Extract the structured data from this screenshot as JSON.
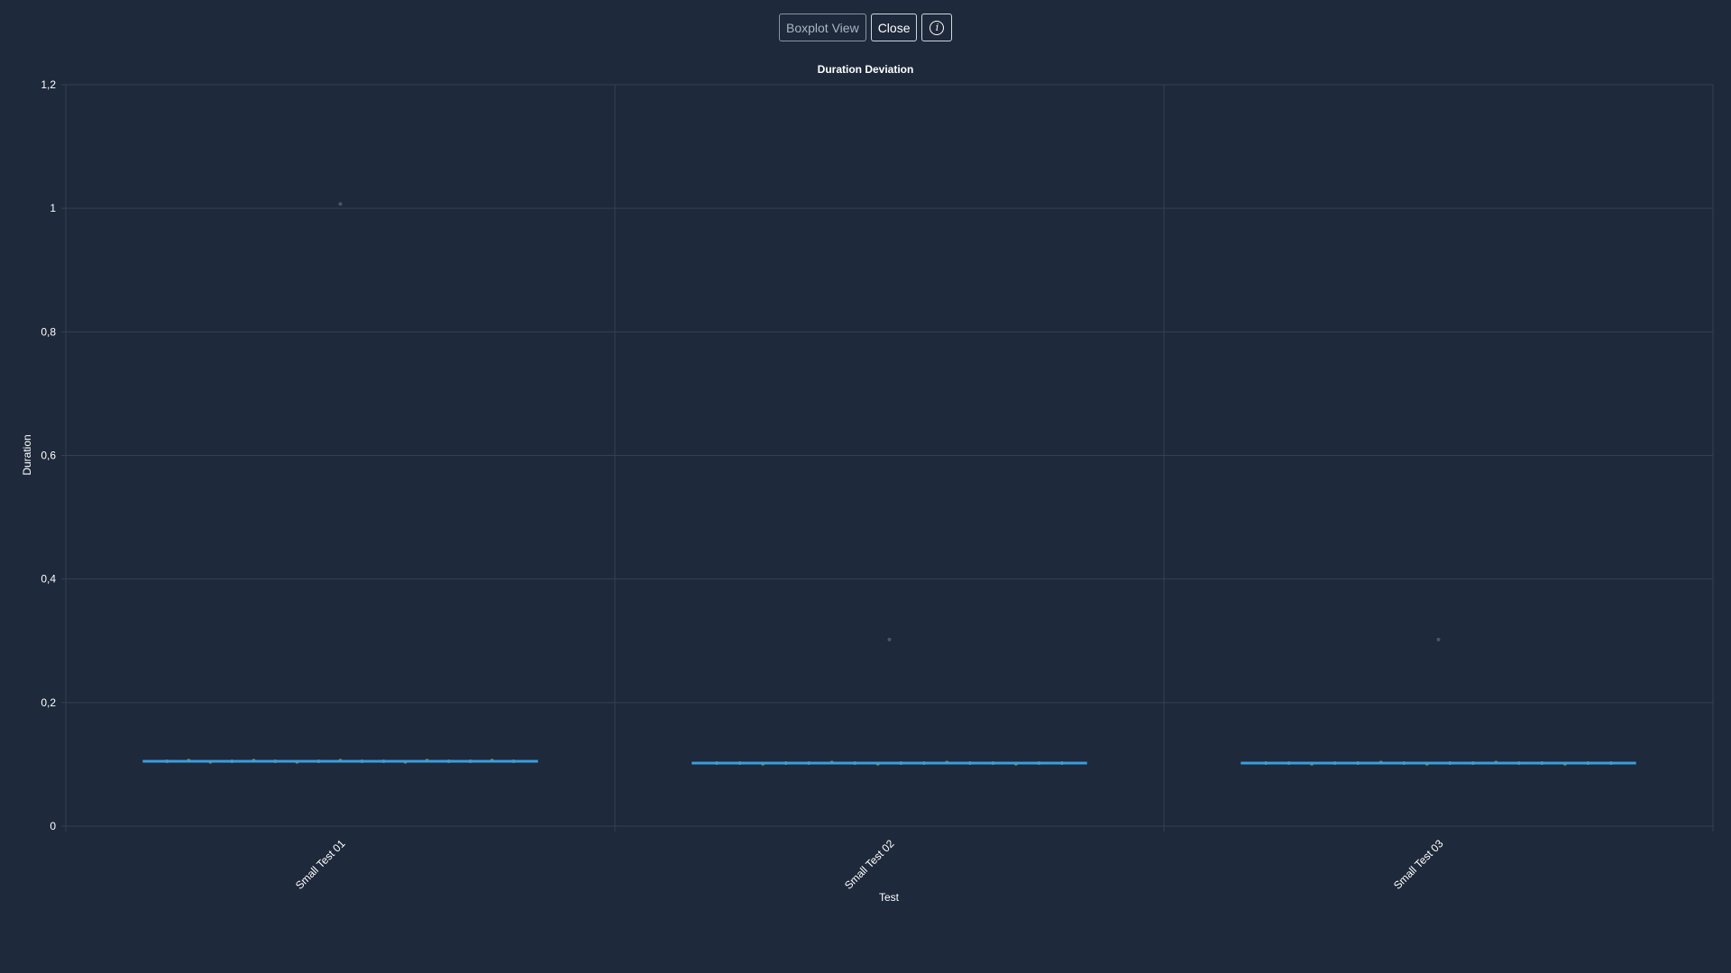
{
  "toolbar": {
    "boxplot_label": "Boxplot View",
    "close_label": "Close",
    "info_icon": "info-icon",
    "info_glyph": "i"
  },
  "colors": {
    "background": "#1e293b",
    "gridline": "#334155",
    "median_line": "#3b9de0",
    "point": "#7c8a3c",
    "outlier": "#4a5568",
    "text": "#ffffff"
  },
  "chart_data": {
    "type": "boxplot",
    "title": "Duration Deviation",
    "xlabel": "Test",
    "ylabel": "Duration",
    "ylim": [
      0,
      1.2
    ],
    "yticks": [
      "0",
      "0,2",
      "0,4",
      "0,6",
      "0,8",
      "1",
      "1,2"
    ],
    "ytick_values": [
      0,
      0.2,
      0.4,
      0.6,
      0.8,
      1.0,
      1.2
    ],
    "grid": true,
    "categories": [
      "Small Test 01",
      "Small Test 02",
      "Small Test 03"
    ],
    "series": [
      {
        "category": "Small Test 01",
        "median": 0.105,
        "points": [
          0.105,
          0.106,
          0.104,
          0.105,
          0.106,
          0.105,
          0.104,
          0.105,
          0.106,
          0.105,
          0.105,
          0.104,
          0.106,
          0.105,
          0.105,
          0.106,
          0.105
        ],
        "outliers": [
          1.007
        ]
      },
      {
        "category": "Small Test 02",
        "median": 0.102,
        "points": [
          0.102,
          0.102,
          0.101,
          0.102,
          0.102,
          0.103,
          0.102,
          0.101,
          0.102,
          0.102,
          0.103,
          0.102,
          0.102,
          0.101,
          0.102,
          0.102
        ],
        "outliers": [
          0.302
        ]
      },
      {
        "category": "Small Test 03",
        "median": 0.102,
        "points": [
          0.102,
          0.102,
          0.101,
          0.102,
          0.102,
          0.103,
          0.102,
          0.101,
          0.102,
          0.102,
          0.103,
          0.102,
          0.102,
          0.101,
          0.102,
          0.102
        ],
        "outliers": [
          0.302
        ]
      }
    ]
  }
}
